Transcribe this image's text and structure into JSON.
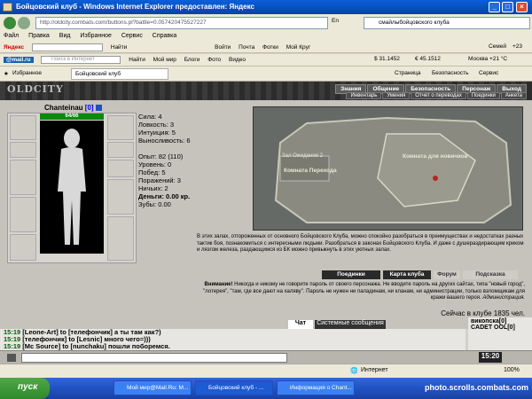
{
  "window": {
    "title": "Бойцовский клуб - Windows Internet Explorer предоставлен: Яндекс"
  },
  "address": {
    "url": "http://oldcity.combats.com/buttons.pl?battle=0.057420475527227",
    "encoding": "En",
    "search_text": "смайлыбойцовского клуба"
  },
  "menu": [
    "Файл",
    "Правка",
    "Вид",
    "Избранное",
    "Сервис",
    "Справка"
  ],
  "yandex_bar": {
    "brand": "Яндекс",
    "find": "Найти",
    "items": [
      "Войти",
      "Почта",
      "Фотки",
      "Мой Круг",
      "Семей",
      "+23"
    ]
  },
  "mail_bar": {
    "brand": "@mail.ru",
    "placeholder": "Поиск в Интернет",
    "find": "Найти",
    "items": [
      "Мой мир",
      "Блоги",
      "Фото",
      "Видео"
    ],
    "rates": [
      "$ 31.1452",
      "€ 45.1512"
    ],
    "weather": "Москва +21 °C"
  },
  "fav_bar": {
    "favorites": "Избранное",
    "tab": "Бойцовский клуб",
    "tools": [
      "Страница",
      "Безопасность",
      "Сервис"
    ]
  },
  "game": {
    "logo": "OLDCITY",
    "nav1": [
      "Знания",
      "Общение",
      "Безопасность",
      "Персонаж",
      "Выход"
    ],
    "nav2": [
      "Инвентарь",
      "Умения",
      "Отчет о переводах",
      "Поединки",
      "Анкета"
    ],
    "char": {
      "name": "Chanteinau",
      "level": "[0]",
      "hp": "64/66"
    },
    "stats": {
      "strength": "Сила: 4",
      "agility": "Ловкость: 3",
      "intuition": "Интуиция: 5",
      "stamina": "Выносливость: 6",
      "exp": "Опыт: 82 (110)",
      "level": "Уровень: 0",
      "wins": "Побед: 5",
      "losses": "Поражений: 3",
      "draws": "Ничьих: 2",
      "money": "Деньги: 0.00 кр.",
      "teeth": "Зубы: 0.00"
    },
    "map": {
      "room1": "Зал Ожидания 2",
      "room2": "Комната Перехода",
      "room3": "Комната для новичков"
    },
    "description": "В этих залах, отгороженных от основного Бойцовского Клуба, можно спокойно разобраться в преимуществах и недостатках разных тактик боя, познакомиться с интересными людьми. Разобраться в законах Бойцовского Клуба. И даже с душераздирающим криком и лязгом железа, раздающимся из БК можно привыкнуть в этих уютных залах.",
    "buttons": [
      "Поединки",
      "Карта клуба",
      "Форум",
      "Подсказка"
    ],
    "warning_label": "Внимание!",
    "warning": "Никогда и никому не говорите пароль от своего персонажа. Не вводите пароль на других сайтах, типа \"новый город\", \"лотерея\", \"там, где все дают на халяву\". Пароль не нужен ни паладинам, ни кланам, ни администрации, только взломщикам для кражи вашего героя.",
    "warning_sign": "Администрация.",
    "online": "Сейчас в клубе 1835 чел."
  },
  "chat": {
    "tabs": [
      "Чат",
      "Системные сообщения"
    ],
    "lines": [
      {
        "time": "15:19",
        "text": "[Leone-Art] to [телефончик] а ты там как?)"
      },
      {
        "time": "15:19",
        "text": "[телефончик] to [Lesnic] много чего=)))"
      },
      {
        "time": "15:19",
        "text": "[Mc Source] to [nunchaku] пошли поборемся."
      }
    ],
    "online_list": [
      "викопска[0]",
      "CADET OOL[0]"
    ],
    "clock": "15:20"
  },
  "status": {
    "text": "Интернет",
    "zone": "100%"
  },
  "taskbar": {
    "start": "пуск",
    "tasks": [
      "Мой мир@Mail.Ru: M...",
      "Бойцовский клуб - ...",
      "Информация о Chant..."
    ],
    "watermark": "photo.scrolls.combats.com"
  }
}
